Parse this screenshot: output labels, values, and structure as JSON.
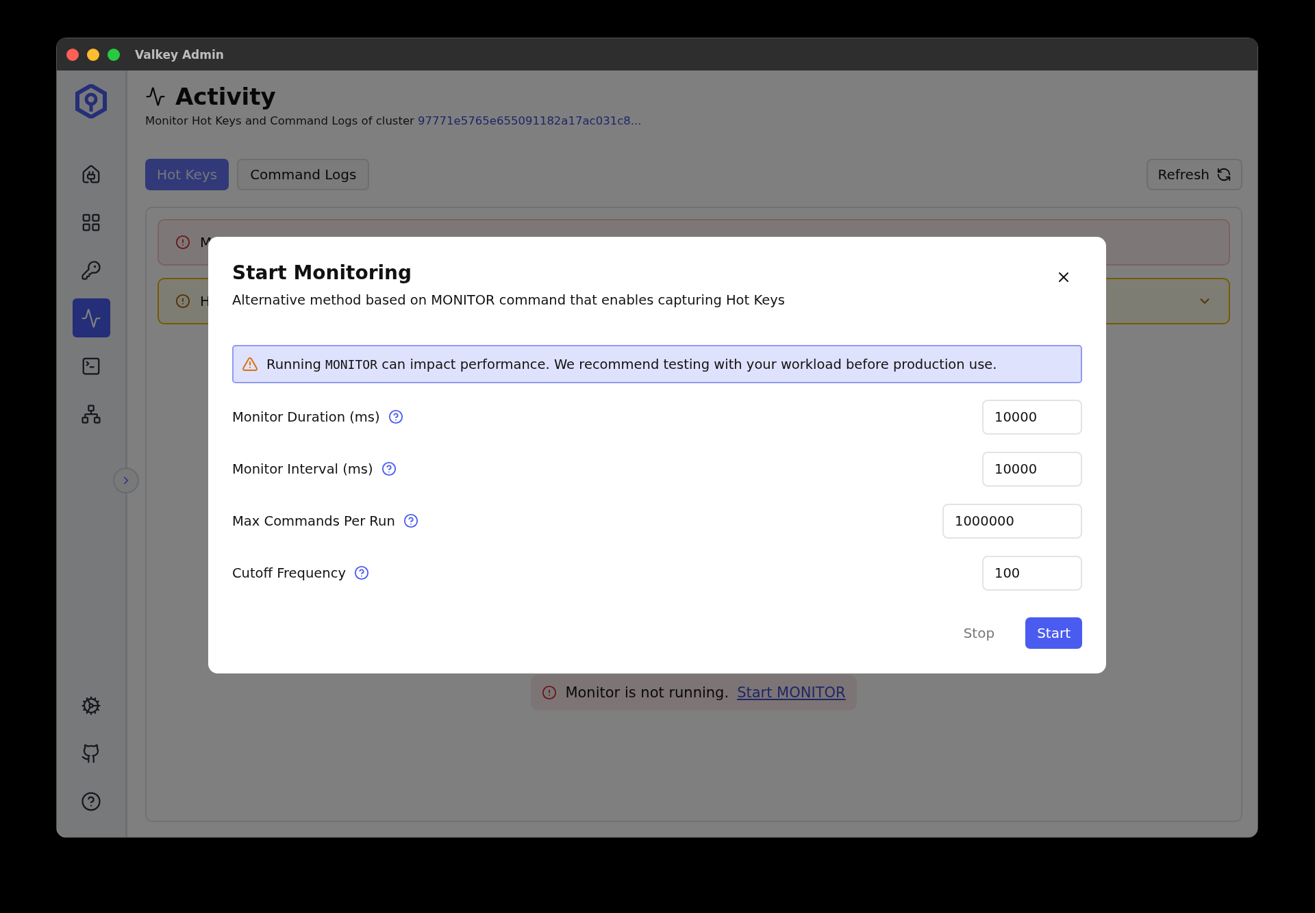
{
  "window": {
    "title": "Valkey Admin"
  },
  "sidebar": {
    "items": [
      {
        "selected": false
      },
      {
        "selected": false
      },
      {
        "selected": false
      },
      {
        "selected": true
      },
      {
        "selected": false
      },
      {
        "selected": false
      }
    ],
    "bottom_items": [
      {
        "selected": false
      },
      {
        "selected": false
      },
      {
        "selected": false
      }
    ]
  },
  "header": {
    "title": "Activity",
    "subtitle": "Monitor Hot Keys and Command Logs of cluster",
    "cluster_link": "97771e5765e655091182a17ac031c8..."
  },
  "tabs": [
    {
      "label": "Hot Keys",
      "selected": true
    },
    {
      "label": "Command Logs",
      "selected": false
    }
  ],
  "refresh_button": "Refresh",
  "alerts": [
    {
      "kind": "error",
      "text": "M"
    },
    {
      "kind": "warning",
      "text": "H"
    }
  ],
  "status_message": {
    "text": "Monitor is not running.",
    "link": "Start MONITOR"
  },
  "dialog": {
    "title": "Start Monitoring",
    "description": "Alternative method based on MONITOR command that enables capturing Hot Keys",
    "warning": [
      {
        "kind": "text",
        "text": "Running "
      },
      {
        "kind": "code",
        "text": "MONITOR"
      },
      {
        "kind": "text",
        "text": " can impact performance. We recommend testing with your workload before production use."
      }
    ],
    "fields": [
      {
        "label": "Monitor Duration (ms)",
        "value": "10000"
      },
      {
        "label": "Monitor Interval (ms)",
        "value": "10000"
      },
      {
        "label": "Max Commands Per Run",
        "value": "1000000"
      },
      {
        "label": "Cutoff Frequency",
        "value": "100"
      }
    ],
    "buttons": [
      {
        "label": "Stop",
        "kind": "secondary"
      },
      {
        "label": "Start",
        "kind": "primary"
      }
    ]
  }
}
